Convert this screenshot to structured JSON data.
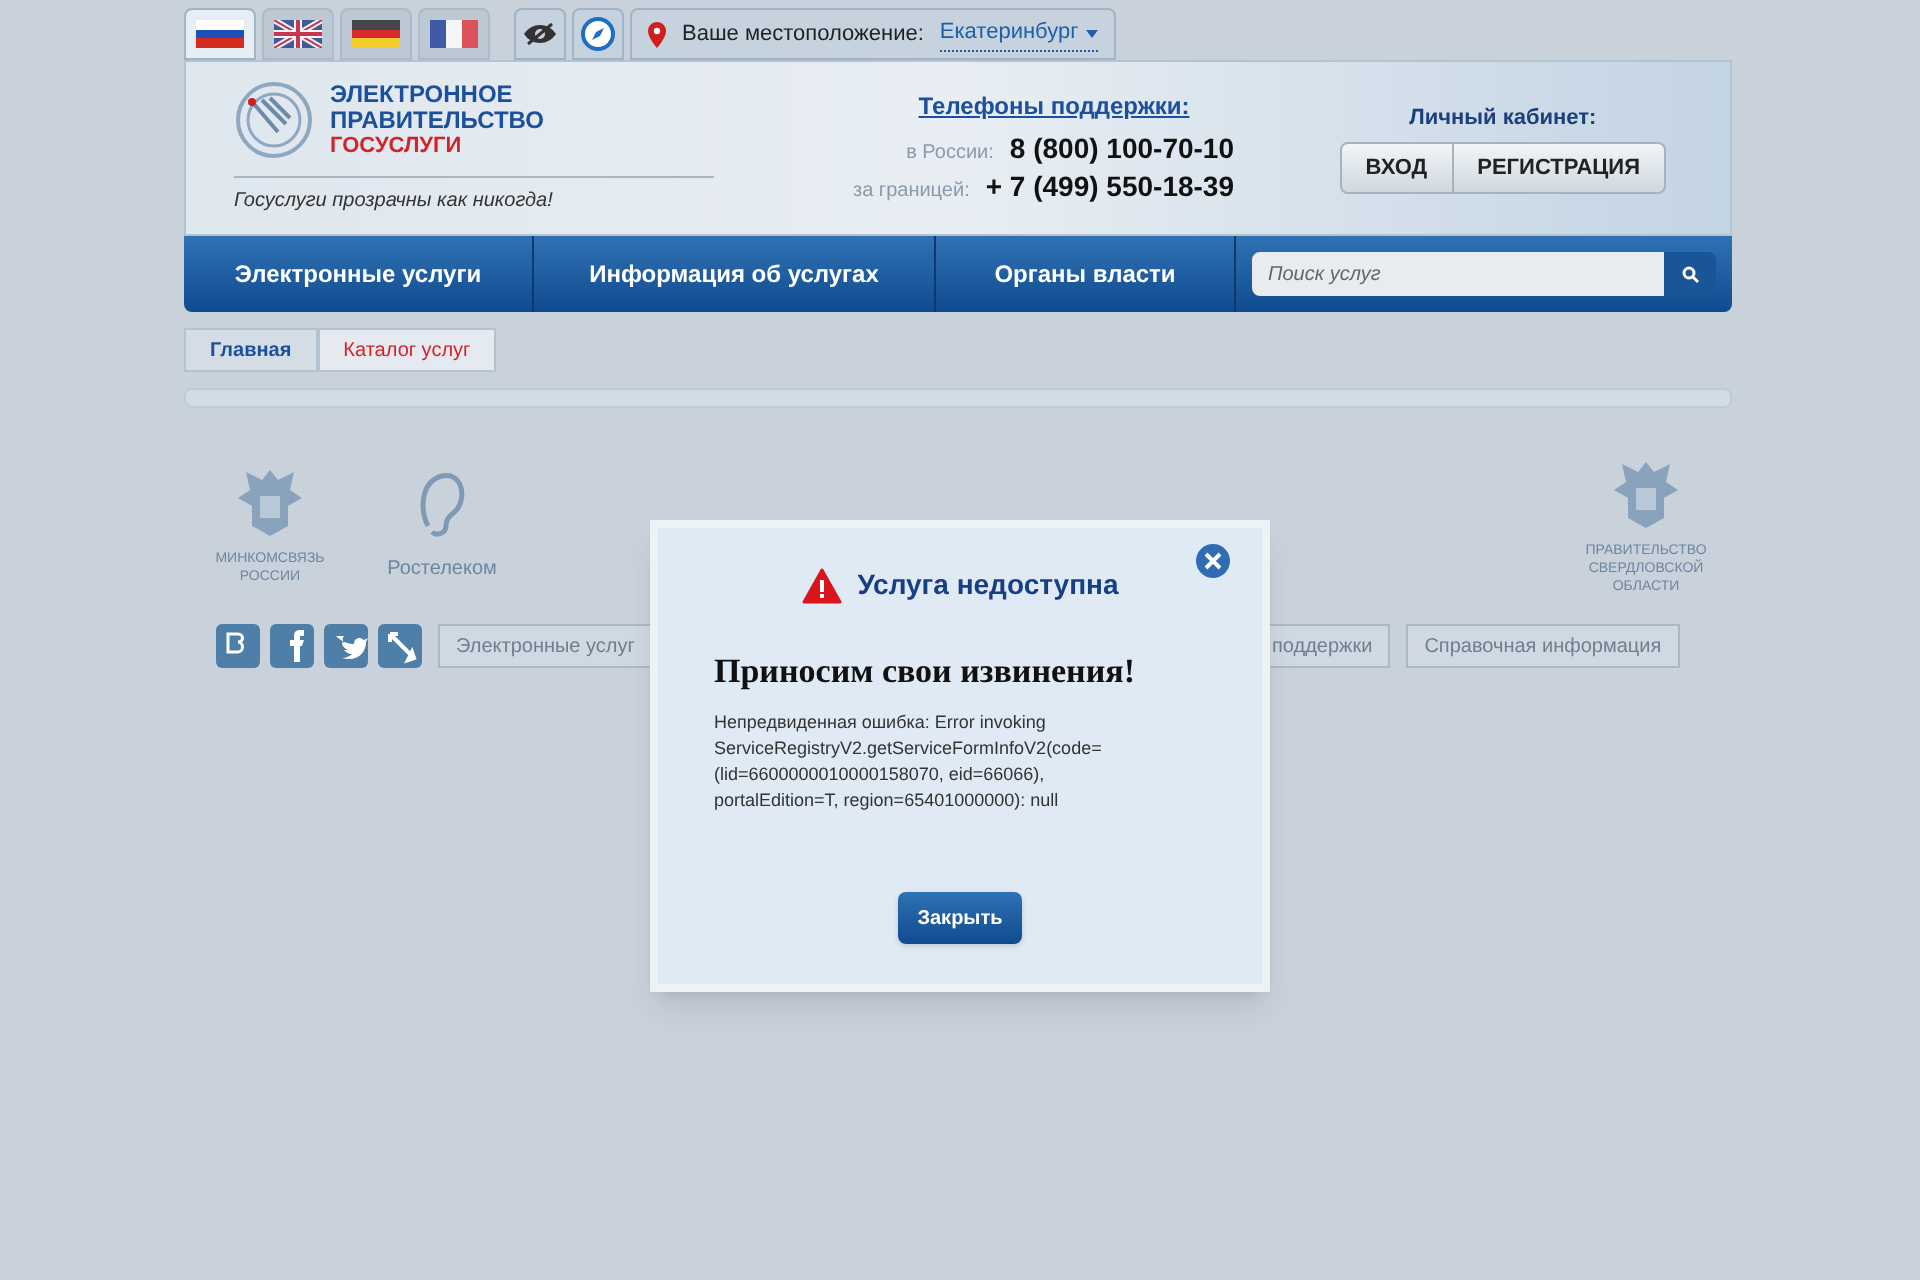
{
  "language_tabs": [
    {
      "kind": "ru",
      "selected": true
    },
    {
      "kind": "gb",
      "selected": false
    },
    {
      "kind": "de",
      "selected": false
    },
    {
      "kind": "fr",
      "selected": false
    }
  ],
  "location": {
    "label": "Ваше местоположение:",
    "city": "Екатеринбург"
  },
  "logo": {
    "line1": "ЭЛЕКТРОННОЕ",
    "line2": "ПРАВИТЕЛЬСТВО",
    "line3": "ГОСУСЛУГИ",
    "slogan": "Госуслуги прозрачны как никогда!"
  },
  "support": {
    "title": "Телефоны поддержки:",
    "phones": [
      {
        "label": "в России:",
        "number": "8 (800) 100-70-10"
      },
      {
        "label": "за границей:",
        "number": "+ 7 (499) 550-18-39"
      }
    ]
  },
  "account": {
    "title": "Личный кабинет:",
    "buttons": [
      "ВХОД",
      "РЕГИСТРАЦИЯ"
    ]
  },
  "nav": {
    "items": [
      "Электронные услуги",
      "Информация об услугах",
      "Органы власти"
    ],
    "search": {
      "placeholder": "Поиск услуг"
    }
  },
  "breadcrumbs": [
    {
      "label": "Главная",
      "selected": false
    },
    {
      "label": "Каталог услуг",
      "selected": true
    }
  ],
  "partners": [
    {
      "kind": "emblem",
      "caption": "МИНКОМСВЯЗЬ РОССИИ"
    },
    {
      "kind": "rostelecom",
      "caption": "Ростелеком"
    },
    {
      "kind": "emblem",
      "caption": "ПРАВИТЕЛЬСТВО СВЕРДЛОВСКОЙ ОБЛАСТИ"
    }
  ],
  "social": [
    {
      "kind": "vk"
    },
    {
      "kind": "facebook"
    },
    {
      "kind": "twitter"
    },
    {
      "kind": "livejournal"
    }
  ],
  "footer_links": [
    "Электронные услуг",
    "поддержки",
    "Справочная информация"
  ],
  "dialog": {
    "title": "Услуга недоступна",
    "heading": "Приносим свои извинения!",
    "message": "Непредвиденная ошибка: Error invoking ServiceRegistryV2.getServiceFormInfoV2(code=(lid=6600000010000158070, eid=66066), portalEdition=T, region=65401000000): null",
    "button": "Закрыть"
  }
}
